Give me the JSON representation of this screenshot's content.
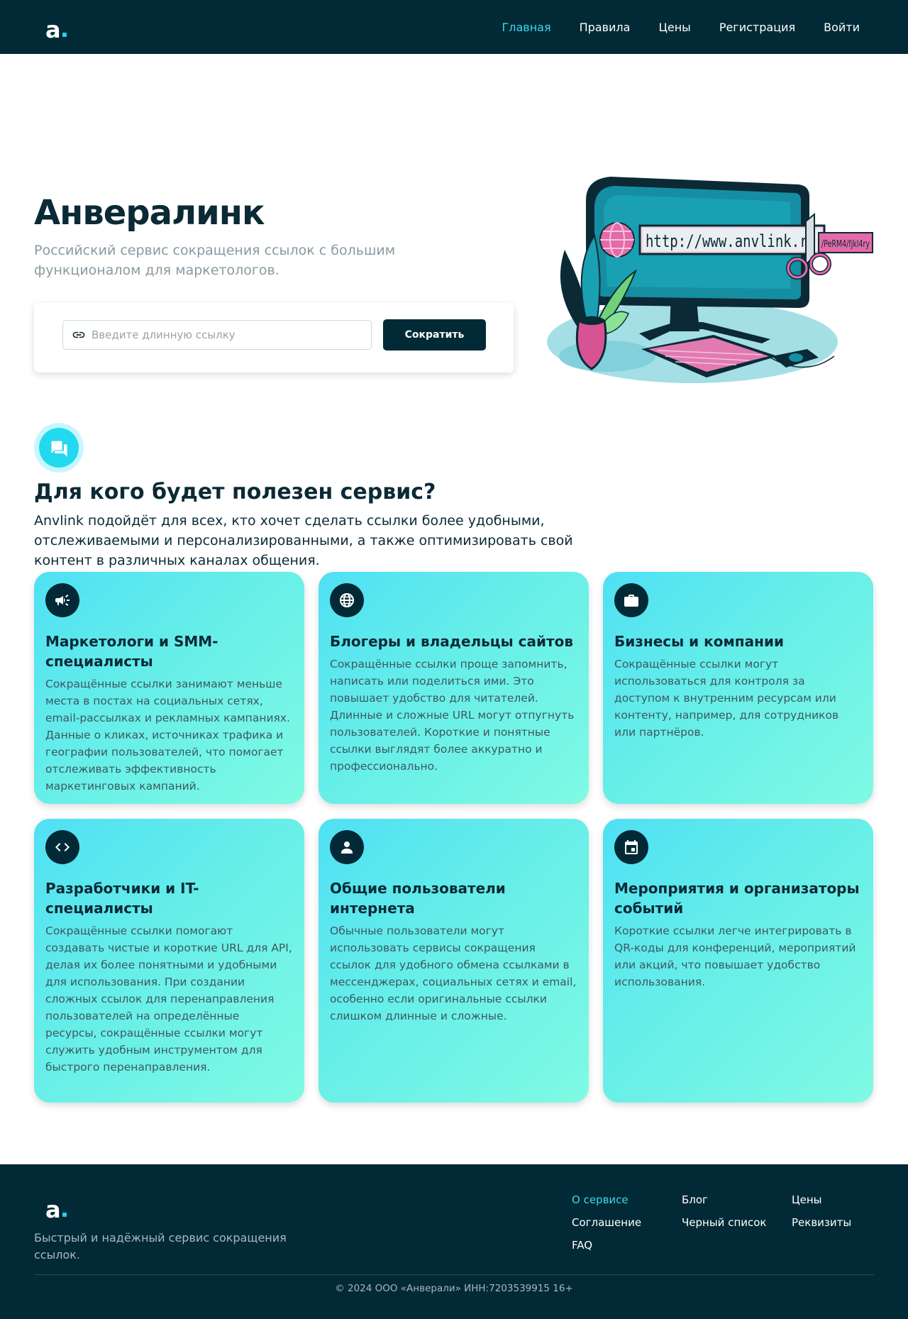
{
  "header": {
    "logo_letter": "a",
    "nav": [
      {
        "label": "Главная",
        "active": true
      },
      {
        "label": "Правила",
        "active": false
      },
      {
        "label": "Цены",
        "active": false
      },
      {
        "label": "Регистрация",
        "active": false
      },
      {
        "label": "Войти",
        "active": false
      }
    ]
  },
  "hero": {
    "title": "Анвералинк",
    "subtitle": "Российский сервис сокращения ссылок с большим функционалом для маркетологов.",
    "input_placeholder": "Введите длинную ссылку",
    "input_value": "",
    "button_label": "Сократить",
    "illustration_url_text": "http://www.anvlink.ru",
    "illustration_url_suffix": "/PeRM4/fjkl4ry"
  },
  "audience": {
    "icon": "chat-icon",
    "title": "Для кого будет полезен сервис?",
    "description": "Anvlink подойдёт для всех, кто хочет сделать ссылки более удобными, отслеживаемыми и персонализированными, а также оптимизировать свой контент в различных каналах общения.",
    "cards": [
      {
        "icon": "megaphone-icon",
        "title": "Маркетологи и SMM-специалисты",
        "text": "Сокращённые ссылки занимают меньше места в постах на социальных сетях, email-рассылках и рекламных кампаниях. Данные о кликах, источниках трафика и географии пользователей, что помогает отслеживать эффективность маркетинговых кампаний."
      },
      {
        "icon": "globe-icon",
        "title": "Блогеры и владельцы сайтов",
        "text": "Сокращённые ссылки проще запомнить, написать или поделиться ими. Это повышает удобство для читателей. Длинные и сложные URL могут отпугнуть пользователей. Короткие и понятные ссылки выглядят более аккуратно и профессионально."
      },
      {
        "icon": "briefcase-icon",
        "title": "Бизнесы и компании",
        "text": "Сокращённые ссылки могут использоваться для контроля за доступом к внутренним ресурсам или контенту, например, для сотрудников или партнёров."
      },
      {
        "icon": "code-icon",
        "title": "Разработчики и IT-специалисты",
        "text": "Сокращённые ссылки помогают создавать чистые и короткие URL для API, делая их более понятными и удобными для использования. При создании сложных ссылок для перенаправления пользователей на определённые ресурсы, сокращённые ссылки могут служить удобным инструментом для быстрого перенаправления."
      },
      {
        "icon": "user-icon",
        "title": "Общие пользователи интернета",
        "text": "Обычные пользователи могут использовать сервисы сокращения ссылок для удобного обмена ссылками в мессенджерах, социальных сетях и email, особенно если оригинальные ссылки слишком длинные и сложные."
      },
      {
        "icon": "calendar-icon",
        "title": "Мероприятия и организаторы событий",
        "text": "Короткие ссылки легче интегрировать в QR-коды для конференций, мероприятий или акций, что повышает удобство использования."
      }
    ]
  },
  "footer": {
    "logo_letter": "a",
    "text": "Быстрый и надёжный сервис сокращения ссылок.",
    "links": [
      {
        "label": "О сервисе",
        "active": true
      },
      {
        "label": "Блог",
        "active": false
      },
      {
        "label": "Цены",
        "active": false
      },
      {
        "label": "Соглашение",
        "active": false
      },
      {
        "label": "Черный список",
        "active": false
      },
      {
        "label": "Реквизиты",
        "active": false
      },
      {
        "label": "FAQ",
        "active": false
      }
    ],
    "copyright": "© 2024 ООО «Анверали» ИНН:7203539915 16+"
  },
  "colors": {
    "dark": "#012a36",
    "accent": "#3fd6ec",
    "card_gradient_start": "#4fe0f4",
    "card_gradient_end": "#7ffae4"
  }
}
